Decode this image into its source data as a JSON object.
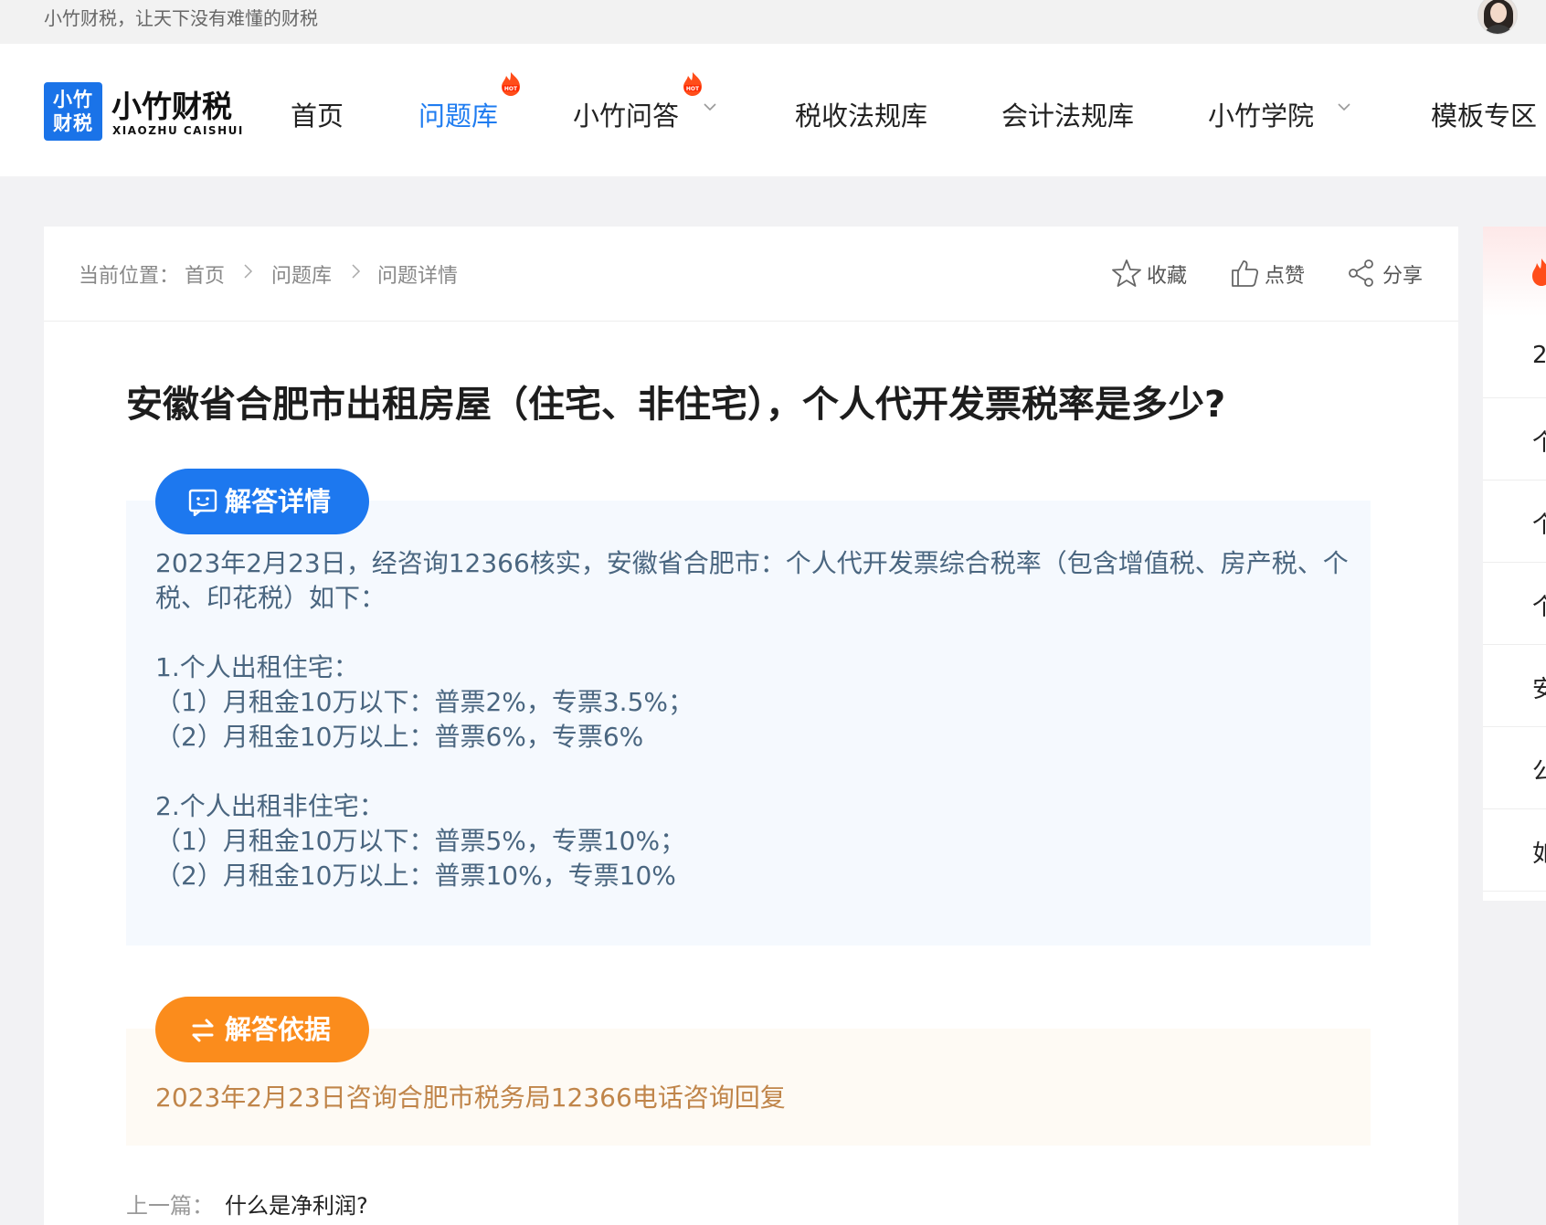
{
  "topbar": {
    "slogan": "小竹财税，让天下没有难懂的财税"
  },
  "logo": {
    "mark_line1": "小竹",
    "mark_line2": "财税",
    "name": "小竹财税",
    "name_en": "XIAOZHU CAISHUI"
  },
  "nav": {
    "items": [
      {
        "label": "首页",
        "active": false
      },
      {
        "label": "问题库",
        "active": true,
        "badge": "HOT"
      },
      {
        "label": "小竹问答",
        "active": false,
        "badge": "HOT",
        "dropdown": true
      },
      {
        "label": "税收法规库",
        "active": false
      },
      {
        "label": "会计法规库",
        "active": false
      },
      {
        "label": "小竹学院",
        "active": false,
        "dropdown": true
      },
      {
        "label": "模板专区",
        "active": false
      }
    ]
  },
  "breadcrumb": {
    "prefix": "当前位置：",
    "items": [
      "首页",
      "问题库",
      "问题详情"
    ]
  },
  "actions": {
    "favorite": "收藏",
    "like": "点赞",
    "share": "分享"
  },
  "question": {
    "title": "安徽省合肥市出租房屋（住宅、非住宅），个人代开发票税率是多少?"
  },
  "answer": {
    "label": "解答详情",
    "paragraphs": [
      "2023年2月23日，经咨询12366核实，安徽省合肥市：个人代开发票综合税率（包含增值税、房产税、个税、印花税）如下：",
      "",
      "1.个人出租住宅：",
      "（1）月租金10万以下：普票2%，专票3.5%；",
      "（2）月租金10万以上：普票6%，专票6%",
      "",
      "2.个人出租非住宅：",
      "（1）月租金10万以下：普票5%，专票10%；",
      "（2）月租金10万以上：普票10%，专票10%"
    ]
  },
  "basis": {
    "label": "解答依据",
    "text": "2023年2月23日咨询合肥市税务局12366电话咨询回复"
  },
  "prev": {
    "label": "上一篇：",
    "title": "什么是净利润?"
  },
  "sidebar": {
    "rows": [
      "2",
      "个",
      "个",
      "个",
      "安",
      "公",
      "如"
    ]
  },
  "colors": {
    "brand_blue": "#1d78ef",
    "orange": "#fb8c1c",
    "answer_text": "#4a6680",
    "basis_text": "#c0854a",
    "hot": "#ff4d1a"
  }
}
